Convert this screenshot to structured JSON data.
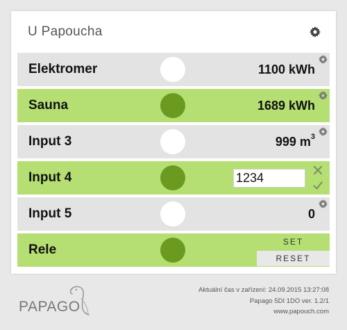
{
  "app": {
    "title": "U Papoucha"
  },
  "colors": {
    "row_gray": "#e3e3e3",
    "row_green": "#b5df72",
    "indicator_on": "#6b9a21",
    "indicator_off": "#ffffff"
  },
  "rows": [
    {
      "label": "Elektromer",
      "indicator": "off",
      "value": "1100 kWh",
      "style": "gray",
      "icon": "gear-icon"
    },
    {
      "label": "Sauna",
      "indicator": "on",
      "value": "1689 kWh",
      "style": "green",
      "icon": "gear-icon"
    },
    {
      "label": "Input 3",
      "indicator": "off",
      "value": "999 m",
      "unit_sup": "3",
      "style": "gray",
      "icon": "gear-icon"
    },
    {
      "label": "Input 4",
      "indicator": "on",
      "input_value": "1234",
      "style": "green",
      "icons": [
        "close-icon",
        "check-icon"
      ]
    },
    {
      "label": "Input 5",
      "indicator": "off",
      "value": "0",
      "style": "gray",
      "icon": "gear-icon"
    },
    {
      "label": "Rele",
      "indicator": "on",
      "style": "green",
      "buttons": {
        "set": "SET",
        "reset": "RESET"
      }
    }
  ],
  "footer": {
    "time_line": "Aktuální čas v zařízení: 24.09.2015 13:27:08",
    "device_line": "Papago 5DI 1DO ver. 1.2/1",
    "url": "www.papouch.com",
    "logo_text": "PAPAGO"
  }
}
